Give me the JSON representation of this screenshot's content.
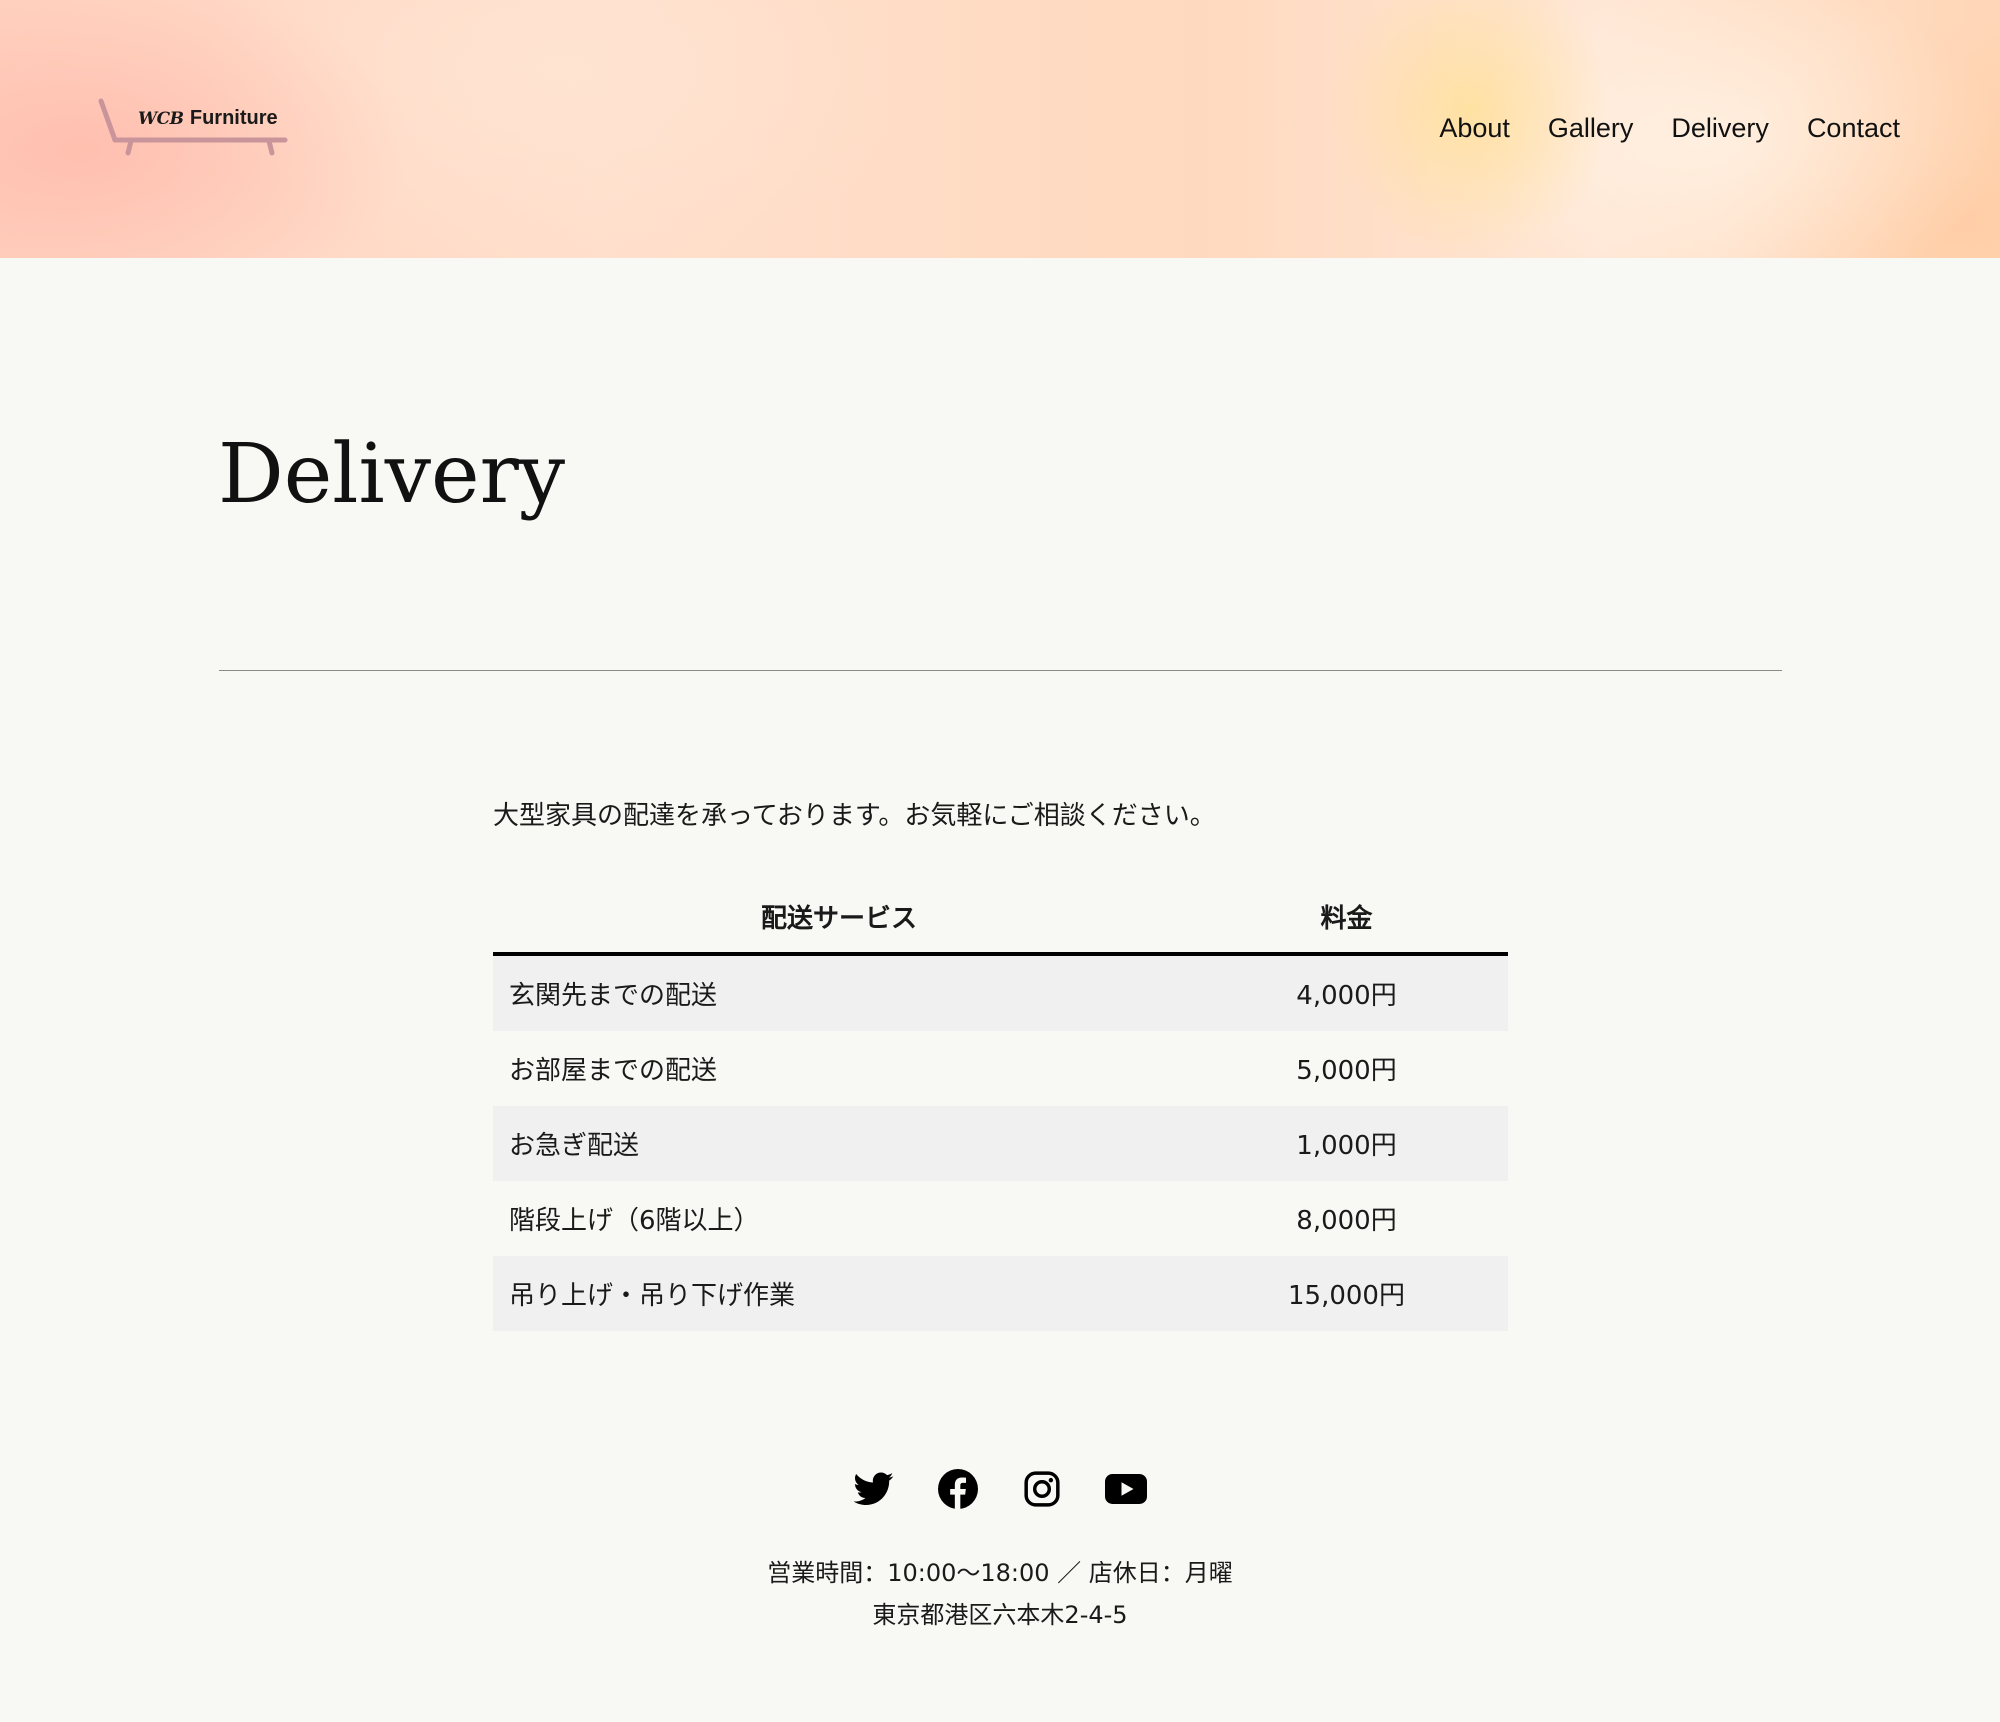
{
  "header": {
    "logo": {
      "prefix": "WCB",
      "name": "Furniture",
      "icon": "lounge-chair-icon",
      "color": "#c9959a"
    },
    "nav": [
      {
        "label": "About"
      },
      {
        "label": "Gallery"
      },
      {
        "label": "Delivery"
      },
      {
        "label": "Contact"
      }
    ]
  },
  "main": {
    "title": "Delivery",
    "intro": "大型家具の配達を承っております。お気軽にご相談ください。",
    "table": {
      "headers": {
        "service": "配送サービス",
        "fee": "料金"
      },
      "rows": [
        {
          "service": "玄関先までの配送",
          "fee": "4,000円"
        },
        {
          "service": "お部屋までの配送",
          "fee": "5,000円"
        },
        {
          "service": "お急ぎ配送",
          "fee": "1,000円"
        },
        {
          "service": "階段上げ（6階以上）",
          "fee": "8,000円"
        },
        {
          "service": "吊り上げ・吊り下げ作業",
          "fee": "15,000円"
        }
      ]
    }
  },
  "footer": {
    "social": [
      {
        "icon": "twitter-icon"
      },
      {
        "icon": "facebook-icon"
      },
      {
        "icon": "instagram-icon"
      },
      {
        "icon": "youtube-icon"
      }
    ],
    "hours": "営業時間：10:00〜18:00 ／ 店休日：月曜",
    "address": "東京都港区六本木2-4-5"
  },
  "colors": {
    "background": "#f8f8f4",
    "row_stripe": "#f0f0f0",
    "text": "#111111",
    "header_gradient": [
      "#ffd3c0",
      "#ffe1a0",
      "#ffd6b6"
    ]
  }
}
